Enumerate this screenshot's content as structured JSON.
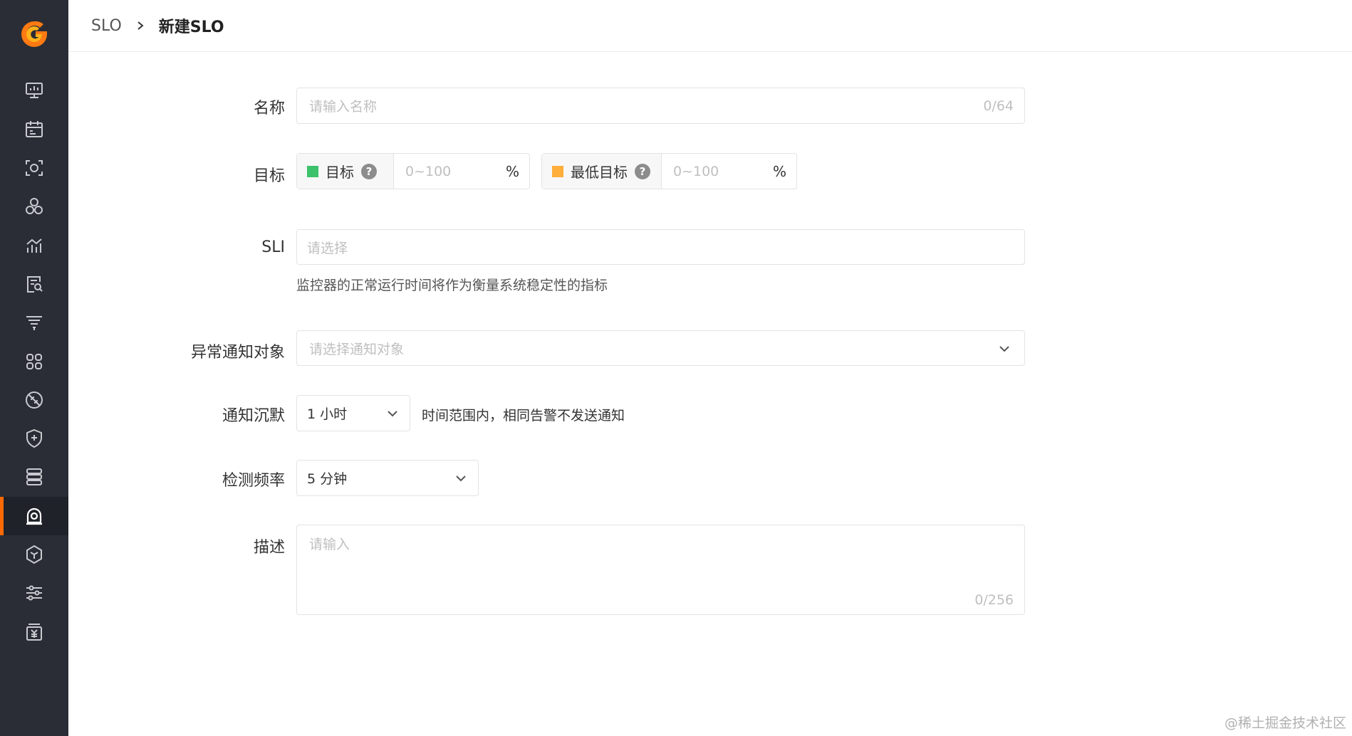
{
  "sidebar": {
    "logo": "g-logo",
    "accent": "#ff6a00",
    "items": [
      {
        "icon": "dashboard-icon"
      },
      {
        "icon": "calendar-icon"
      },
      {
        "icon": "scan-icon"
      },
      {
        "icon": "cluster-icon"
      },
      {
        "icon": "metrics-chart-icon"
      },
      {
        "icon": "log-search-icon"
      },
      {
        "icon": "filter-lines-icon"
      },
      {
        "icon": "apps-grid-icon"
      },
      {
        "icon": "no-signal-icon"
      },
      {
        "icon": "shield-plus-icon"
      },
      {
        "icon": "server-stack-icon"
      },
      {
        "icon": "monitor-target-icon",
        "active": true
      },
      {
        "icon": "package-hexagon-icon"
      },
      {
        "icon": "sliders-icon"
      },
      {
        "icon": "billing-yuan-icon"
      }
    ]
  },
  "breadcrumb": {
    "parent": "SLO",
    "current": "新建SLO"
  },
  "form": {
    "name": {
      "label": "名称",
      "placeholder": "请输入名称",
      "counter": "0/64"
    },
    "target": {
      "label": "目标",
      "goal": {
        "label": "目标",
        "placeholder": "0~100",
        "unit": "%",
        "color": "#3cc26b"
      },
      "min_goal": {
        "label": "最低目标",
        "placeholder": "0~100",
        "unit": "%",
        "color": "#ffad3b"
      },
      "help_glyph": "?"
    },
    "sli": {
      "label": "SLI",
      "placeholder": "请选择",
      "hint": "监控器的正常运行时间将作为衡量系统稳定性的指标"
    },
    "notify_target": {
      "label": "异常通知对象",
      "placeholder": "请选择通知对象"
    },
    "silence": {
      "label": "通知沉默",
      "value": "1 小时",
      "hint": "时间范围内，相同告警不发送通知"
    },
    "frequency": {
      "label": "检测频率",
      "value": "5 分钟"
    },
    "description": {
      "label": "描述",
      "placeholder": "请输入",
      "counter": "0/256"
    }
  },
  "watermark": "@稀土掘金技术社区"
}
